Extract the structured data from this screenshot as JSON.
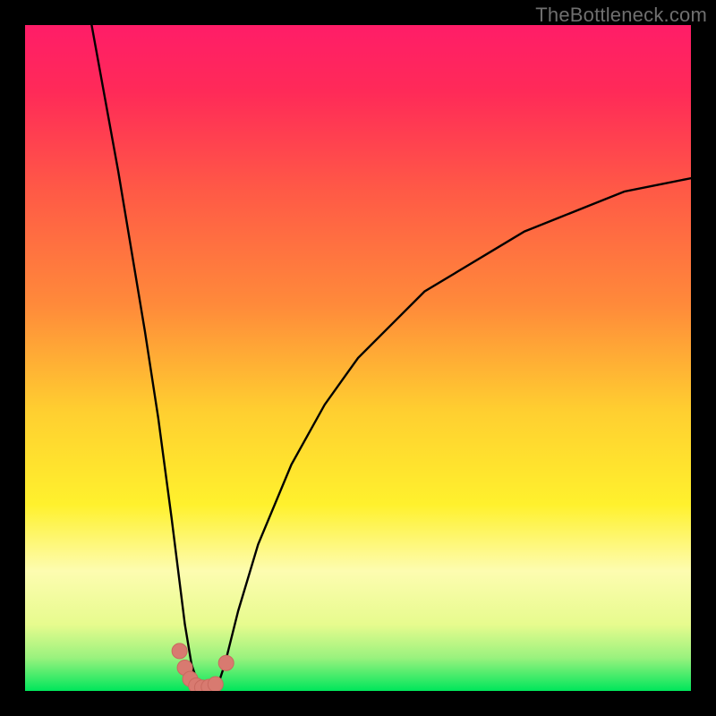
{
  "watermark": "TheBottleneck.com",
  "colors": {
    "black": "#000000",
    "curve": "#000000",
    "marker_fill": "#d87a70",
    "marker_stroke": "#c9695f",
    "green": "#00e65b",
    "greenSoft": "#9af27e",
    "greenPale": "#e7fb8e",
    "yellowPale": "#fdfcb0",
    "yellow": "#fff12d",
    "orangeYellow": "#ffcf30",
    "orange": "#ff8a3a",
    "coral": "#ff5a46",
    "redPink": "#ff2a58",
    "magenta": "#ff1d68"
  },
  "chart_data": {
    "type": "line",
    "title": "",
    "xlabel": "",
    "ylabel": "",
    "xlim": [
      0,
      100
    ],
    "ylim": [
      0,
      100
    ],
    "grid": false,
    "legend": false,
    "note": "V-shaped bottleneck curve. y ≈ 100 at x≈10 (left edge of plotted curve), drops to ≈0 near x≈25–29, rises to ≈77 at x=100. Background is a vertical gradient from magenta/red (top, high bottleneck) through orange/yellow to green (bottom, no bottleneck).",
    "series": [
      {
        "name": "bottleneck-curve",
        "x": [
          10,
          12,
          14,
          16,
          18,
          20,
          22,
          23,
          24,
          25,
          26,
          27,
          28,
          29,
          30,
          32,
          35,
          40,
          45,
          50,
          55,
          60,
          65,
          70,
          75,
          80,
          85,
          90,
          95,
          100
        ],
        "y": [
          100,
          89,
          78,
          66,
          54,
          41,
          26,
          18,
          10,
          4,
          1,
          0,
          0,
          1,
          4,
          12,
          22,
          34,
          43,
          50,
          55,
          60,
          63,
          66,
          69,
          71,
          73,
          75,
          76,
          77
        ]
      }
    ],
    "markers": {
      "name": "near-optimal-points",
      "x": [
        23.2,
        24.0,
        24.8,
        25.7,
        26.6,
        27.6,
        28.6,
        30.2
      ],
      "y": [
        6.0,
        3.5,
        1.8,
        0.8,
        0.5,
        0.6,
        1.0,
        4.2
      ]
    }
  }
}
